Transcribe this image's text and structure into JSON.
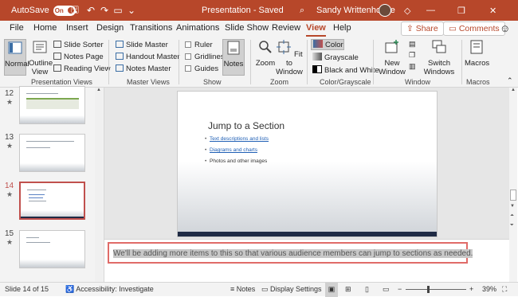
{
  "titlebar": {
    "autosave_label": "AutoSave",
    "autosave_state": "On",
    "doc_title": "Presentation - Saved",
    "user_name": "Sandy Writtenhouse",
    "accent": "#b7472a"
  },
  "tabs": [
    "File",
    "Home",
    "Insert",
    "Design",
    "Transitions",
    "Animations",
    "Slide Show",
    "Review",
    "View",
    "Help"
  ],
  "active_tab": "View",
  "share_label": "Share",
  "comments_label": "Comments",
  "ribbon": {
    "presentation_views": {
      "normal": "Normal",
      "outline": "Outline View",
      "slide_sorter": "Slide Sorter",
      "notes_page": "Notes Page",
      "reading_view": "Reading View",
      "group": "Presentation Views"
    },
    "master_views": {
      "slide_master": "Slide Master",
      "handout_master": "Handout Master",
      "notes_master": "Notes Master",
      "group": "Master Views"
    },
    "show": {
      "ruler": "Ruler",
      "gridlines": "Gridlines",
      "guides": "Guides",
      "notes": "Notes",
      "group": "Show"
    },
    "zoom": {
      "zoom": "Zoom",
      "fit_to_window": "Fit to Window",
      "group": "Zoom"
    },
    "color": {
      "color": "Color",
      "grayscale": "Grayscale",
      "black_white": "Black and White",
      "group": "Color/Grayscale"
    },
    "window": {
      "new_window": "New Window",
      "switch_windows": "Switch Windows",
      "group": "Window"
    },
    "macros": {
      "macros": "Macros",
      "group": "Macros"
    }
  },
  "thumbnails": [
    {
      "num": "12",
      "star": "★"
    },
    {
      "num": "13",
      "star": "★"
    },
    {
      "num": "14",
      "star": "★"
    },
    {
      "num": "15",
      "star": "★"
    }
  ],
  "slide": {
    "title": "Jump to a Section",
    "bullets": [
      "Text descriptions and lists",
      "Diagrams and charts",
      "Photos and other images"
    ]
  },
  "notes_text": "We'll be adding more items to this so that various audience members can jump to sections as needed.",
  "status": {
    "slide_info": "Slide 14 of 15",
    "accessibility": "Accessibility: Investigate",
    "notes": "Notes",
    "display_settings": "Display Settings",
    "zoom_minus": "−",
    "zoom_plus": "+",
    "zoom_level": "39%",
    "zoom_fraction": 0.39
  }
}
